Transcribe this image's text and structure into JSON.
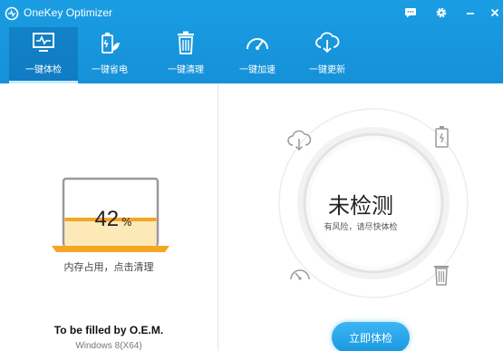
{
  "app": {
    "title": "OneKey Optimizer"
  },
  "window_controls": {
    "chat": "chat-icon",
    "settings": "gear-icon",
    "minimize": "minimize-icon",
    "close": "close-icon"
  },
  "tabs": [
    {
      "label": "一键体检",
      "icon": "monitor-pulse-icon",
      "active": true
    },
    {
      "label": "一键省电",
      "icon": "battery-leaf-icon",
      "active": false
    },
    {
      "label": "一键清理",
      "icon": "trash-icon",
      "active": false
    },
    {
      "label": "一键加速",
      "icon": "speedometer-icon",
      "active": false
    },
    {
      "label": "一键更新",
      "icon": "cloud-download-icon",
      "active": false
    }
  ],
  "memory": {
    "value": "42",
    "unit": "%",
    "fraction": 0.42,
    "label": "内存占用，点击清理"
  },
  "system": {
    "oem": "To be filled by O.E.M.",
    "os": "Windows 8(X64)"
  },
  "status": {
    "main": "未检测",
    "sub": "有风险，请尽快体检"
  },
  "actions": {
    "check_now": "立即体检"
  },
  "colors": {
    "header": "#1a9de3",
    "accent": "#f5a623",
    "button": "#22a2e6"
  }
}
